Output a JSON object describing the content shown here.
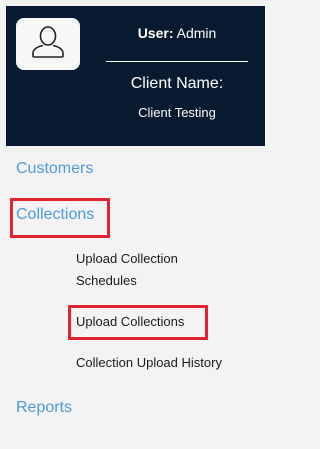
{
  "header": {
    "user_prefix": "User:",
    "user_name": "Admin",
    "client_label": "Client Name:",
    "client_value": "Client Testing",
    "background_color": "#071a2f",
    "avatar_icon": "user-icon"
  },
  "nav": {
    "customers": "Customers",
    "collections": "Collections",
    "collections_sub": {
      "upload_schedules": "Upload Collection Schedules",
      "upload_collections": "Upload Collections",
      "upload_history": "Collection Upload History"
    },
    "reports": "Reports",
    "link_color": "#4f9ad9",
    "highlight_color": "#e0232e"
  }
}
